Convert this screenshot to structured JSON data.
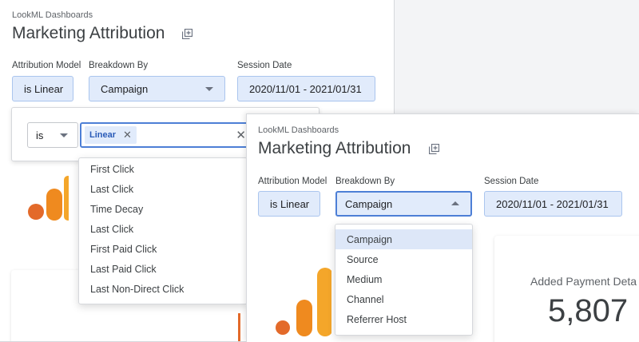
{
  "back_panel": {
    "folder": "LookML Dashboards",
    "title": "Marketing Attribution",
    "filters": {
      "attribution_model": {
        "label": "Attribution Model",
        "value": "is Linear"
      },
      "breakdown_by": {
        "label": "Breakdown By",
        "value": "Campaign"
      },
      "session_date": {
        "label": "Session Date",
        "value": "2020/11/01 - 2021/01/31"
      }
    },
    "popover": {
      "operator": "is",
      "chip": "Linear",
      "options": [
        "First Click",
        "Last Click",
        "Time Decay",
        "Last Click",
        "First Paid Click",
        "Last Paid Click",
        "Last Non-Direct Click"
      ]
    }
  },
  "front_panel": {
    "folder": "LookML Dashboards",
    "title": "Marketing Attribution",
    "filters": {
      "attribution_model": {
        "label": "Attribution Model",
        "value": "is Linear"
      },
      "breakdown_by": {
        "label": "Breakdown By",
        "value": "Campaign"
      },
      "session_date": {
        "label": "Session Date",
        "value": "2020/11/01 - 2021/01/31"
      }
    },
    "breakdown_options": [
      "Campaign",
      "Source",
      "Medium",
      "Channel",
      "Referrer Host"
    ],
    "selected_option": "Campaign",
    "kpi": {
      "label": "Added Payment Deta",
      "value": "5,807"
    }
  },
  "colors": {
    "logo_light": "#f4a62a",
    "logo_mid": "#ef8a1f",
    "logo_dark": "#e36a2a",
    "accent": "#4d7fd6",
    "chip_bg": "#e1ebfb"
  },
  "icons": {
    "copy": "copy-icon",
    "close": "close-icon",
    "caret": "caret-icon"
  }
}
